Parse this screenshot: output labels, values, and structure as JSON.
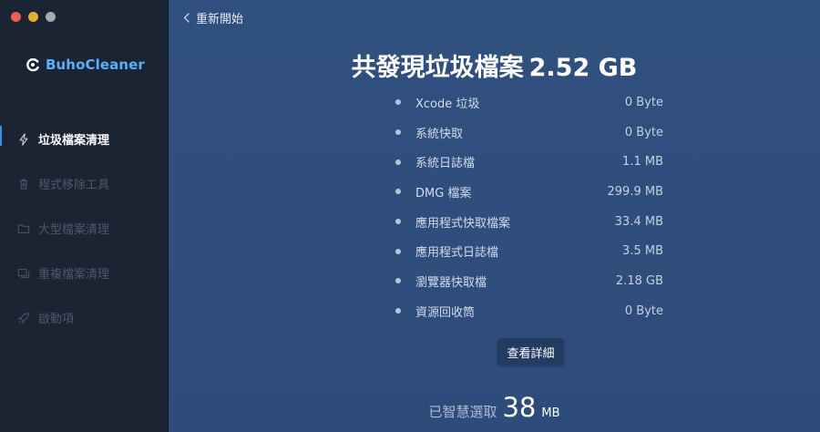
{
  "window": {
    "controls": [
      "close",
      "minimize",
      "maximize"
    ]
  },
  "sidebar": {
    "brand": "BuhoCleaner",
    "items": [
      {
        "label": "垃圾檔案清理",
        "icon": "lightning-icon",
        "active": true
      },
      {
        "label": "程式移除工具",
        "icon": "trash-icon",
        "active": false
      },
      {
        "label": "大型檔案清理",
        "icon": "folder-icon",
        "active": false
      },
      {
        "label": "重複檔案清理",
        "icon": "duplicate-icon",
        "active": false
      },
      {
        "label": "啟動項",
        "icon": "rocket-icon",
        "active": false
      }
    ]
  },
  "header": {
    "back_label": "重新開始"
  },
  "summary": {
    "title_prefix": "共發現垃圾檔案",
    "title_amount": "2.52 GB"
  },
  "items": [
    {
      "name": "Xcode 垃圾",
      "size": "0 Byte"
    },
    {
      "name": "系統快取",
      "size": "0 Byte"
    },
    {
      "name": "系統日誌檔",
      "size": "1.1 MB"
    },
    {
      "name": "DMG 檔案",
      "size": "299.9 MB"
    },
    {
      "name": "應用程式快取檔案",
      "size": "33.4 MB"
    },
    {
      "name": "應用程式日誌檔",
      "size": "3.5 MB"
    },
    {
      "name": "瀏覽器快取檔",
      "size": "2.18 GB"
    },
    {
      "name": "資源回收筒",
      "size": "0 Byte"
    }
  ],
  "details_button": "查看詳細",
  "smart_select": {
    "label": "已智慧選取",
    "value": "38",
    "unit": "MB"
  },
  "colors": {
    "sidebar_bg": "#1b2433",
    "main_bg": "#2f4d7c",
    "brand": "#5aaeff",
    "active_indicator": "#3d8cf0"
  }
}
